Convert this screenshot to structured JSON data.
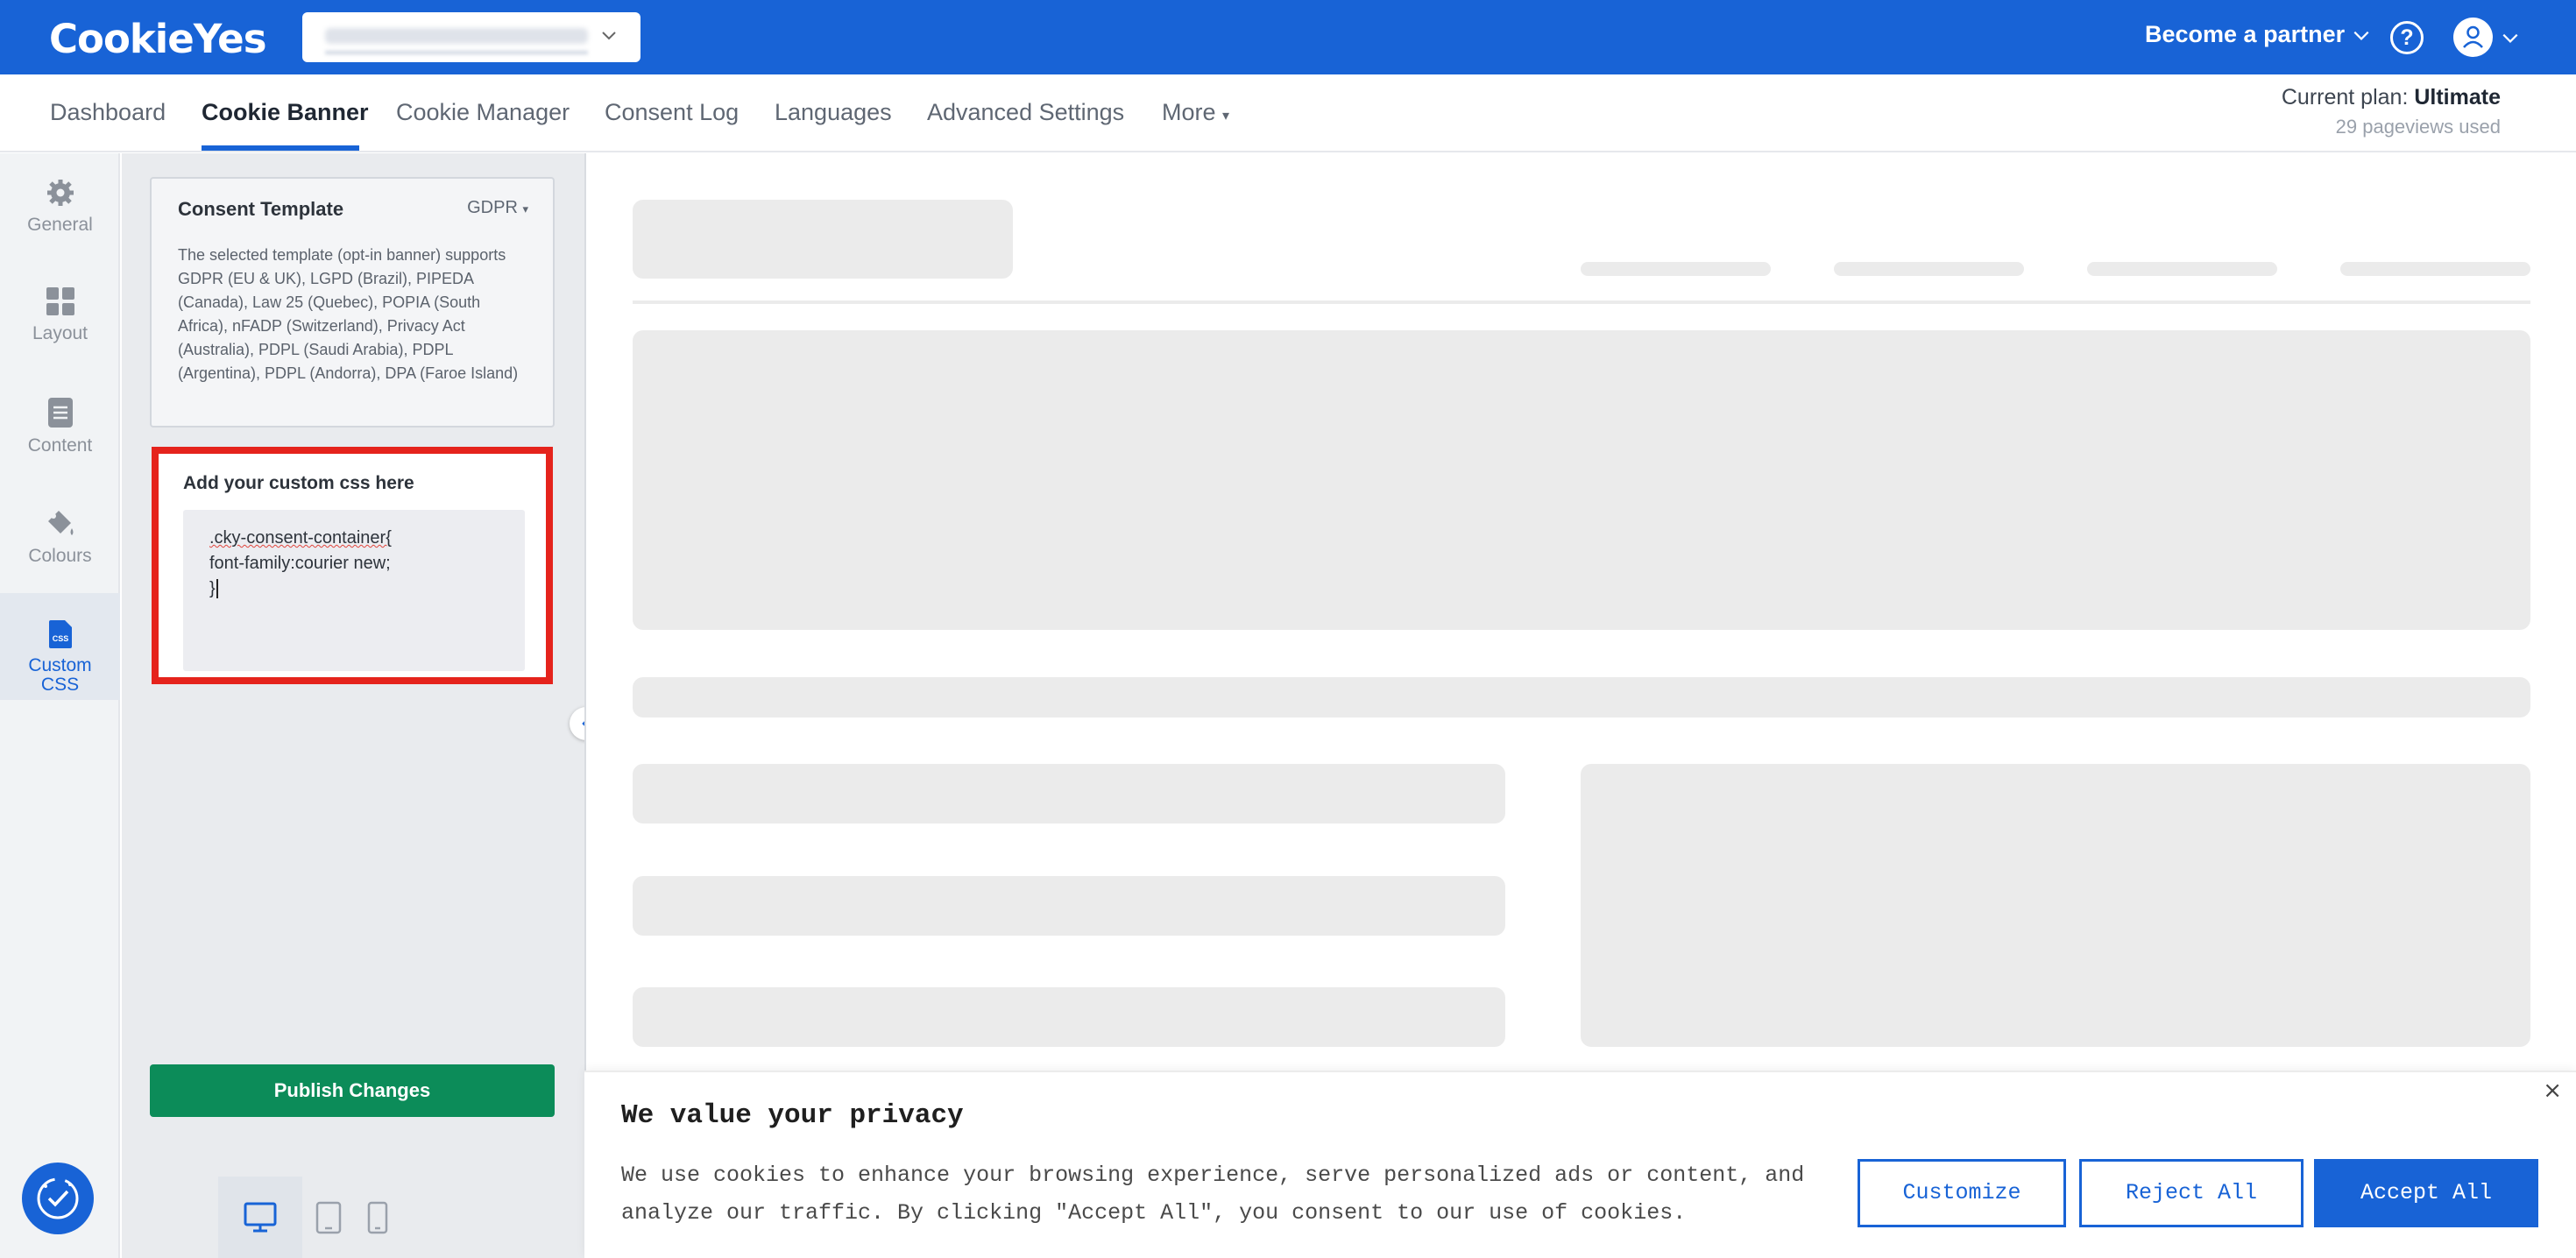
{
  "app": {
    "logo": "CookieYes"
  },
  "header": {
    "partner_label": "Become a partner",
    "help_label": "?"
  },
  "nav": {
    "items": [
      "Dashboard",
      "Cookie Banner",
      "Cookie Manager",
      "Consent Log",
      "Languages",
      "Advanced Settings",
      "More"
    ],
    "active": "Cookie Banner"
  },
  "plan": {
    "label": "Current plan:",
    "name": "Ultimate",
    "usage": "29 pageviews used"
  },
  "rail": {
    "items": [
      {
        "label": "General",
        "icon": "gear-icon"
      },
      {
        "label": "Layout",
        "icon": "grid-icon"
      },
      {
        "label": "Content",
        "icon": "document-icon"
      },
      {
        "label": "Colours",
        "icon": "paint-bucket-icon"
      },
      {
        "label": "Custom CSS",
        "icon": "css-file-icon"
      }
    ],
    "active": "Custom CSS"
  },
  "template": {
    "title": "Consent Template",
    "selected": "GDPR",
    "description": "The selected template (opt-in banner) supports GDPR (EU & UK), LGPD (Brazil), PIPEDA (Canada), Law 25 (Quebec), POPIA (South Africa), nFADP (Switzerland), Privacy Act (Australia), PDPL (Saudi Arabia), PDPL (Argentina), PDPL (Andorra), DPA (Faroe Island)"
  },
  "custom_css": {
    "label": "Add your custom css here",
    "line1": ".cky-consent-container{",
    "line2": "font-family:courier new;",
    "line3": "}"
  },
  "actions": {
    "publish_label": "Publish Changes"
  },
  "devices": {
    "options": [
      "desktop-icon",
      "tablet-icon",
      "mobile-icon"
    ],
    "selected": "desktop-icon"
  },
  "banner": {
    "title": "We value your privacy",
    "text": "We use cookies to enhance your browsing experience, serve personalized ads or content, and analyze our traffic. By clicking \"Accept All\", you consent to our use of cookies.",
    "close": "×",
    "customize_label": "Customize",
    "reject_label": "Reject All",
    "accept_label": "Accept All"
  },
  "colors": {
    "brand": "#1863d6",
    "publish": "#0c8c59",
    "highlight": "#e5231c"
  }
}
